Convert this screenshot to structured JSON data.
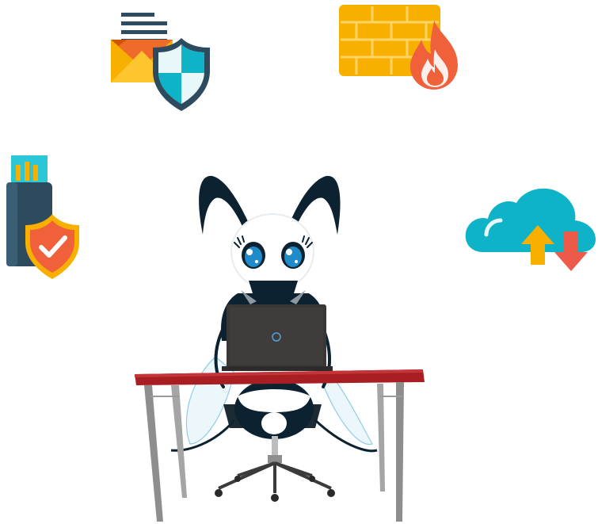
{
  "scene": {
    "description_icons": [
      "secure-mail-icon",
      "firewall-icon",
      "secure-usb-icon",
      "cloud-sync-icon",
      "ant-mascot-at-desk"
    ],
    "colors": {
      "navy": "#2e4a5f",
      "navy_light": "#3a5f75",
      "amber": "#f8b000",
      "orange": "#f57c00",
      "red_orange": "#f0603a",
      "teal": "#0fb3c7",
      "teal_light": "#2bc6d8",
      "cloud_arrow_up": "#f8b000",
      "cloud_arrow_down": "#ee5a4a",
      "desk_top": "#a81e22",
      "desk_legs": "#8e8e8e",
      "laptop": "#3b3737",
      "ant_body": "#0d2230",
      "eye_blue": "#1f8bc9"
    }
  }
}
